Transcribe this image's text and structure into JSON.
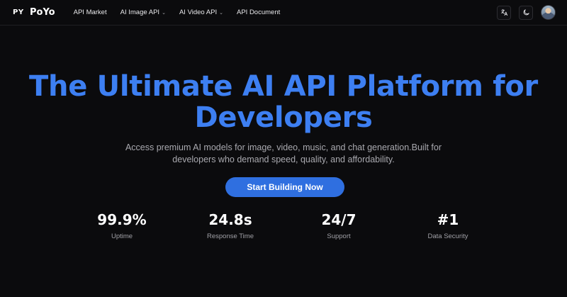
{
  "brand": {
    "mark": "PY",
    "name": "PoYo"
  },
  "nav": {
    "items": [
      {
        "label": "API Market",
        "dropdown": false
      },
      {
        "label": "AI Image API",
        "dropdown": true
      },
      {
        "label": "AI Video API",
        "dropdown": true
      },
      {
        "label": "API Document",
        "dropdown": false
      }
    ]
  },
  "header_icons": [
    "translate-icon",
    "moon-icon",
    "user-avatar"
  ],
  "hero": {
    "title_line1": "The Ultimate AI API Platform for",
    "title_line2": "Developers",
    "subtitle_line1": "Access premium AI models for image, video, music, and chat generation.Built for",
    "subtitle_line2": "developers who demand speed, quality, and affordability.",
    "cta_label": "Start Building Now"
  },
  "stats": [
    {
      "value": "99.9%",
      "label": "Uptime"
    },
    {
      "value": "24.8s",
      "label": "Response Time"
    },
    {
      "value": "24/7",
      "label": "Support"
    },
    {
      "value": "#1",
      "label": "Data Security"
    }
  ],
  "colors": {
    "background": "#0b0b0d",
    "accent": "#3d7ff2",
    "button": "#2f6fe0",
    "muted_text": "#a9a9af"
  }
}
